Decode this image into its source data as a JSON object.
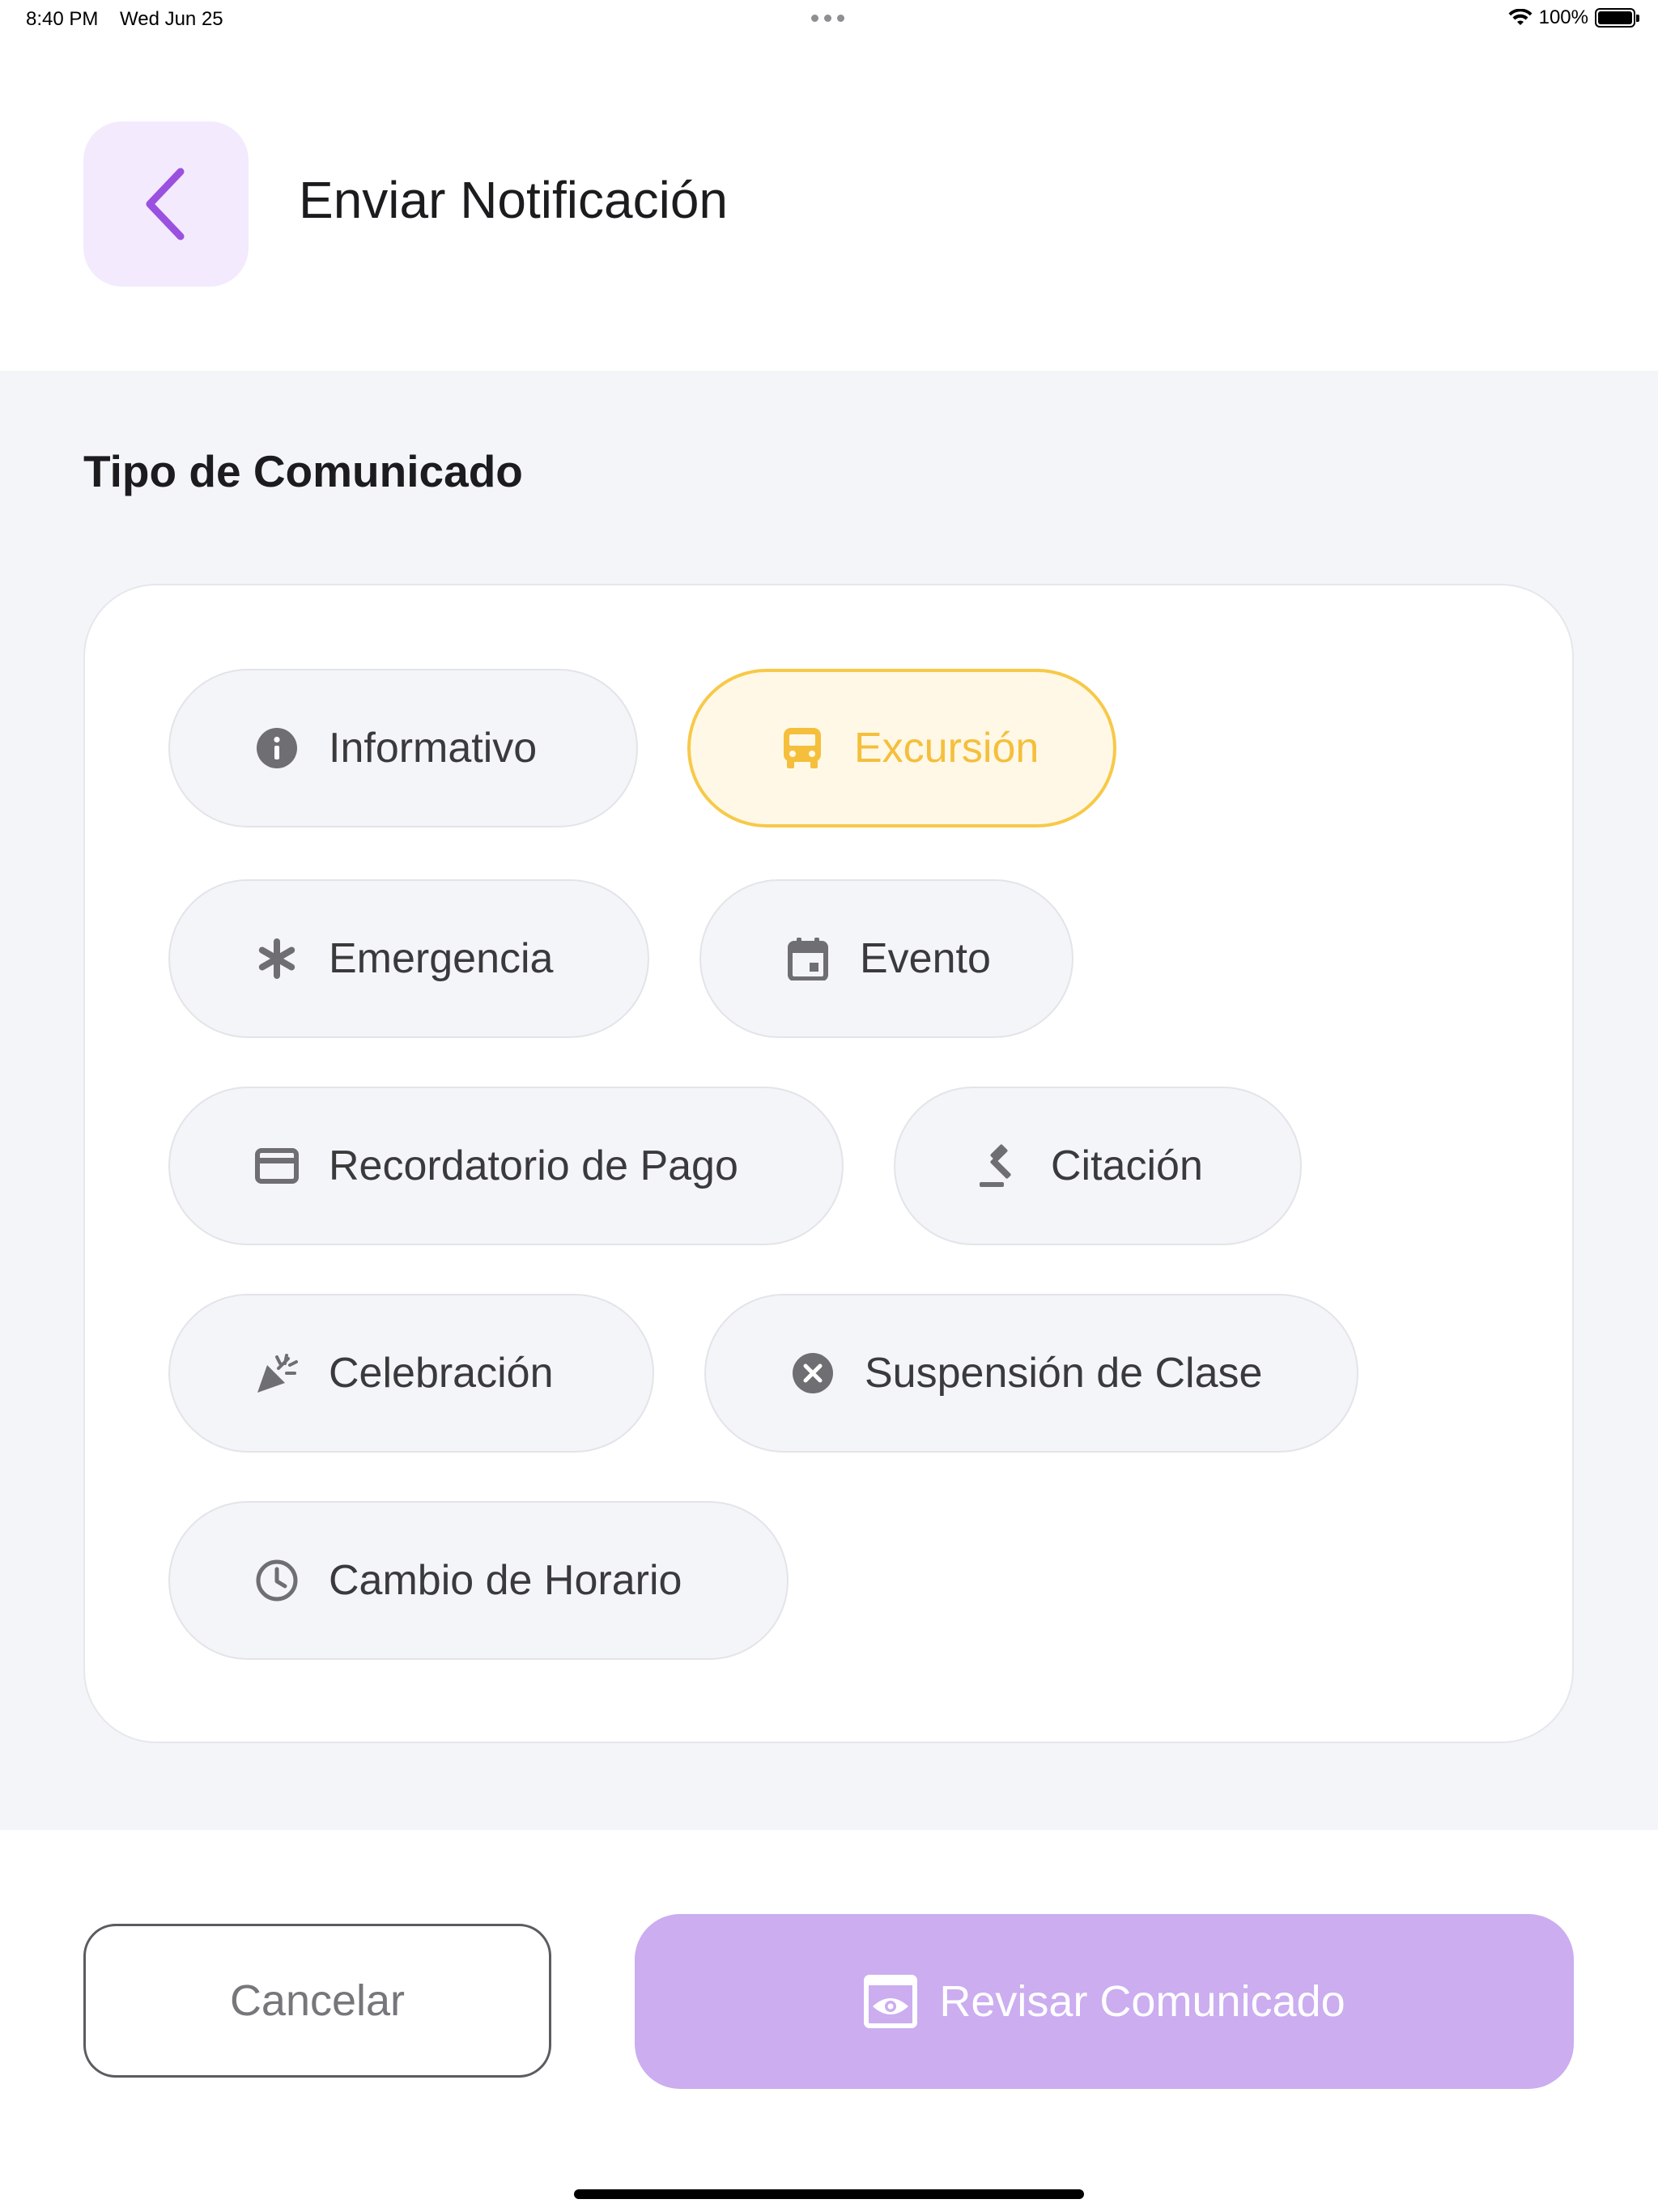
{
  "status_bar": {
    "time": "8:40 PM",
    "date": "Wed Jun 25",
    "battery": "100%",
    "battery_level": 1.0
  },
  "header": {
    "back_icon": "chevron-left-icon",
    "title": "Enviar Notificación"
  },
  "section": {
    "title": "Tipo de Comunicado"
  },
  "chips": [
    {
      "label": "Informativo",
      "icon": "info-icon",
      "selected": false
    },
    {
      "label": "Excursión",
      "icon": "bus-icon",
      "selected": true
    },
    {
      "label": "Emergencia",
      "icon": "asterisk-icon",
      "selected": false
    },
    {
      "label": "Evento",
      "icon": "calendar-icon",
      "selected": false
    },
    {
      "label": "Recordatorio de Pago",
      "icon": "credit-card-icon",
      "selected": false
    },
    {
      "label": "Citación",
      "icon": "gavel-icon",
      "selected": false
    },
    {
      "label": "Celebración",
      "icon": "party-popper-icon",
      "selected": false
    },
    {
      "label": "Suspensión de Clase",
      "icon": "cancel-circle-icon",
      "selected": false
    },
    {
      "label": "Cambio de Horario",
      "icon": "clock-icon",
      "selected": false
    }
  ],
  "footer": {
    "cancel_label": "Cancelar",
    "review_label": "Revisar Comunicado",
    "review_icon": "preview-eye-icon"
  },
  "colors": {
    "accent": "#9b51e0",
    "accent_light": "#cbadf0",
    "selected_chip_border": "#f7c948",
    "selected_chip_text": "#f5bf3c",
    "section_background": "#f4f5f9"
  }
}
